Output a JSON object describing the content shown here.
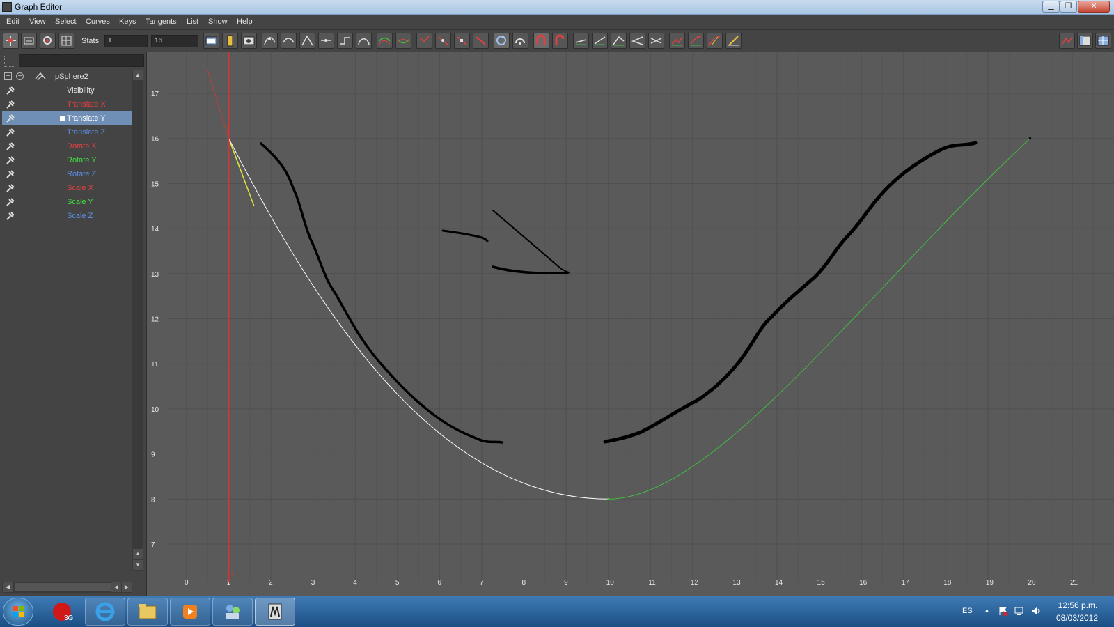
{
  "window": {
    "title": "Graph Editor"
  },
  "menubar": {
    "items": [
      "Edit",
      "View",
      "Select",
      "Curves",
      "Keys",
      "Tangents",
      "List",
      "Show",
      "Help"
    ]
  },
  "toolbar": {
    "stats_label": "Stats",
    "stats_value_1": "1",
    "stats_value_2": "16"
  },
  "outliner": {
    "node_label": "pSphere2",
    "attributes": [
      {
        "label": "Visibility",
        "color": "#e8e8e8",
        "selected": false
      },
      {
        "label": "Translate X",
        "color": "#e84040",
        "selected": false
      },
      {
        "label": "Translate Y",
        "color": "#ffffff",
        "selected": true
      },
      {
        "label": "Translate Z",
        "color": "#5b8fe8",
        "selected": false
      },
      {
        "label": "Rotate X",
        "color": "#e84040",
        "selected": false
      },
      {
        "label": "Rotate Y",
        "color": "#40e040",
        "selected": false
      },
      {
        "label": "Rotate Z",
        "color": "#5b8fe8",
        "selected": false
      },
      {
        "label": "Scale X",
        "color": "#e84040",
        "selected": false
      },
      {
        "label": "Scale Y",
        "color": "#40e040",
        "selected": false
      },
      {
        "label": "Scale Z",
        "color": "#5b8fe8",
        "selected": false
      }
    ]
  },
  "graph": {
    "x_ticks": [
      "0",
      "1",
      "2",
      "3",
      "4",
      "5",
      "6",
      "7",
      "8",
      "9",
      "10",
      "11",
      "12",
      "13",
      "14",
      "15",
      "16",
      "17",
      "18",
      "19",
      "20",
      "21"
    ],
    "y_ticks": [
      "17",
      "16",
      "15",
      "14",
      "13",
      "12",
      "11",
      "10",
      "9",
      "8",
      "7"
    ],
    "current_frame_label": "1",
    "time_indicator_color": "#e03030",
    "curve_color_selected": "#ffffff",
    "curve_color_green": "#40c040"
  },
  "taskbar": {
    "lang": "ES",
    "time": "12:56 p.m.",
    "date": "08/03/2012"
  }
}
